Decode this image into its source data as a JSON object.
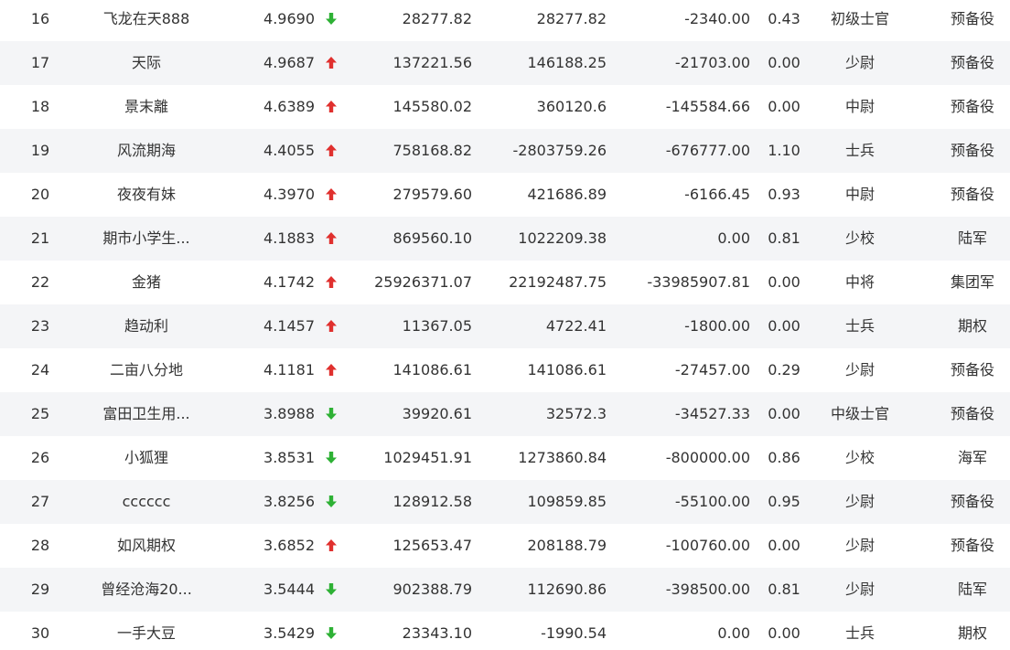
{
  "colors": {
    "up": "#e0302e",
    "down": "#2eb135",
    "text": "#333333",
    "stripe": "#f4f5f7"
  },
  "rows": [
    {
      "rank": "16",
      "name": "飞龙在天888",
      "score": "4.9690",
      "trend": "down",
      "v1": "28277.82",
      "v2": "28277.82",
      "v3": "-2340.00",
      "ratio": "0.43",
      "grade": "初级士官",
      "corps": "预备役"
    },
    {
      "rank": "17",
      "name": "天际",
      "score": "4.9687",
      "trend": "up",
      "v1": "137221.56",
      "v2": "146188.25",
      "v3": "-21703.00",
      "ratio": "0.00",
      "grade": "少尉",
      "corps": "预备役"
    },
    {
      "rank": "18",
      "name": "景末離",
      "score": "4.6389",
      "trend": "up",
      "v1": "145580.02",
      "v2": "360120.6",
      "v3": "-145584.66",
      "ratio": "0.00",
      "grade": "中尉",
      "corps": "预备役"
    },
    {
      "rank": "19",
      "name": "风流期海",
      "score": "4.4055",
      "trend": "up",
      "v1": "758168.82",
      "v2": "-2803759.26",
      "v3": "-676777.00",
      "ratio": "1.10",
      "grade": "士兵",
      "corps": "预备役"
    },
    {
      "rank": "20",
      "name": "夜夜有妹",
      "score": "4.3970",
      "trend": "up",
      "v1": "279579.60",
      "v2": "421686.89",
      "v3": "-6166.45",
      "ratio": "0.93",
      "grade": "中尉",
      "corps": "预备役"
    },
    {
      "rank": "21",
      "name": "期市小学生...",
      "score": "4.1883",
      "trend": "up",
      "v1": "869560.10",
      "v2": "1022209.38",
      "v3": "0.00",
      "ratio": "0.81",
      "grade": "少校",
      "corps": "陆军"
    },
    {
      "rank": "22",
      "name": "金猪",
      "score": "4.1742",
      "trend": "up",
      "v1": "25926371.07",
      "v2": "22192487.75",
      "v3": "-33985907.81",
      "ratio": "0.00",
      "grade": "中将",
      "corps": "集团军"
    },
    {
      "rank": "23",
      "name": "趋动利",
      "score": "4.1457",
      "trend": "up",
      "v1": "11367.05",
      "v2": "4722.41",
      "v3": "-1800.00",
      "ratio": "0.00",
      "grade": "士兵",
      "corps": "期权"
    },
    {
      "rank": "24",
      "name": "二亩八分地",
      "score": "4.1181",
      "trend": "up",
      "v1": "141086.61",
      "v2": "141086.61",
      "v3": "-27457.00",
      "ratio": "0.29",
      "grade": "少尉",
      "corps": "预备役"
    },
    {
      "rank": "25",
      "name": "富田卫生用...",
      "score": "3.8988",
      "trend": "down",
      "v1": "39920.61",
      "v2": "32572.3",
      "v3": "-34527.33",
      "ratio": "0.00",
      "grade": "中级士官",
      "corps": "预备役"
    },
    {
      "rank": "26",
      "name": "小狐狸",
      "score": "3.8531",
      "trend": "down",
      "v1": "1029451.91",
      "v2": "1273860.84",
      "v3": "-800000.00",
      "ratio": "0.86",
      "grade": "少校",
      "corps": "海军"
    },
    {
      "rank": "27",
      "name": "cccccc",
      "score": "3.8256",
      "trend": "down",
      "v1": "128912.58",
      "v2": "109859.85",
      "v3": "-55100.00",
      "ratio": "0.95",
      "grade": "少尉",
      "corps": "预备役"
    },
    {
      "rank": "28",
      "name": "如风期权",
      "score": "3.6852",
      "trend": "up",
      "v1": "125653.47",
      "v2": "208188.79",
      "v3": "-100760.00",
      "ratio": "0.00",
      "grade": "少尉",
      "corps": "预备役"
    },
    {
      "rank": "29",
      "name": "曾经沧海20...",
      "score": "3.5444",
      "trend": "down",
      "v1": "902388.79",
      "v2": "112690.86",
      "v3": "-398500.00",
      "ratio": "0.81",
      "grade": "少尉",
      "corps": "陆军"
    },
    {
      "rank": "30",
      "name": "一手大豆",
      "score": "3.5429",
      "trend": "down",
      "v1": "23343.10",
      "v2": "-1990.54",
      "v3": "0.00",
      "ratio": "0.00",
      "grade": "士兵",
      "corps": "期权"
    }
  ]
}
